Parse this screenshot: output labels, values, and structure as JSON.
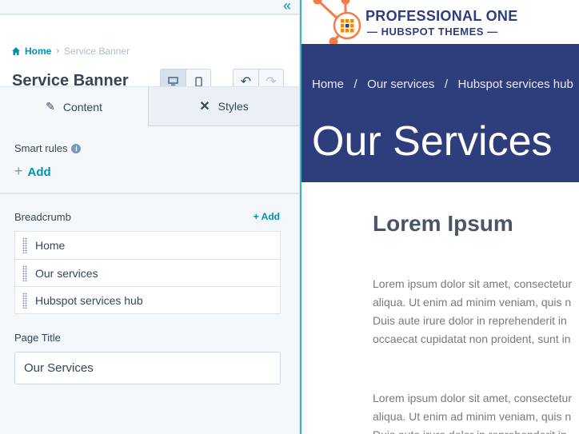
{
  "editor": {
    "collapse_icon": "double-chevron-left-icon",
    "breadcrumb": {
      "home": "Home",
      "current": "Service Banner"
    },
    "title": "Service Banner",
    "tabs": [
      {
        "label": "Content",
        "icon": "pencil-icon",
        "active": true
      },
      {
        "label": "Styles",
        "icon": "brush-icon",
        "active": false
      }
    ],
    "smart_rules": {
      "label": "Smart rules",
      "add": "Add"
    },
    "breadcrumb_field": {
      "label": "Breadcrumb",
      "add": "+ Add",
      "items": [
        "Home",
        "Our services",
        "Hubspot services hub"
      ]
    },
    "page_title": {
      "label": "Page Title",
      "value": "Our Services"
    }
  },
  "preview": {
    "logo": {
      "line1": "PROFESSIONAL ONE",
      "line2": "— HUBSPOT THEMES —"
    },
    "breadcrumb": "Home   /   Our services   /   Hubspot services hub",
    "banner_title": "Our Services",
    "heading": "Lorem Ipsum",
    "para1": [
      "Lorem ipsum dolor sit amet, consectetur",
      "aliqua. Ut enim ad minim veniam, quis n",
      "Duis aute irure dolor in reprehenderit in",
      "occaecat cupidatat non proident, sunt in"
    ],
    "para2": [
      "Lorem ipsum dolor sit amet, consectetur",
      "aliqua. Ut enim ad minim veniam, quis n",
      "Duis aute irure dolor in reprehenderit in"
    ]
  },
  "colors": {
    "accent": "#0091ae",
    "banner": "#2e3d7c",
    "logo_orange": "#f47c48"
  }
}
